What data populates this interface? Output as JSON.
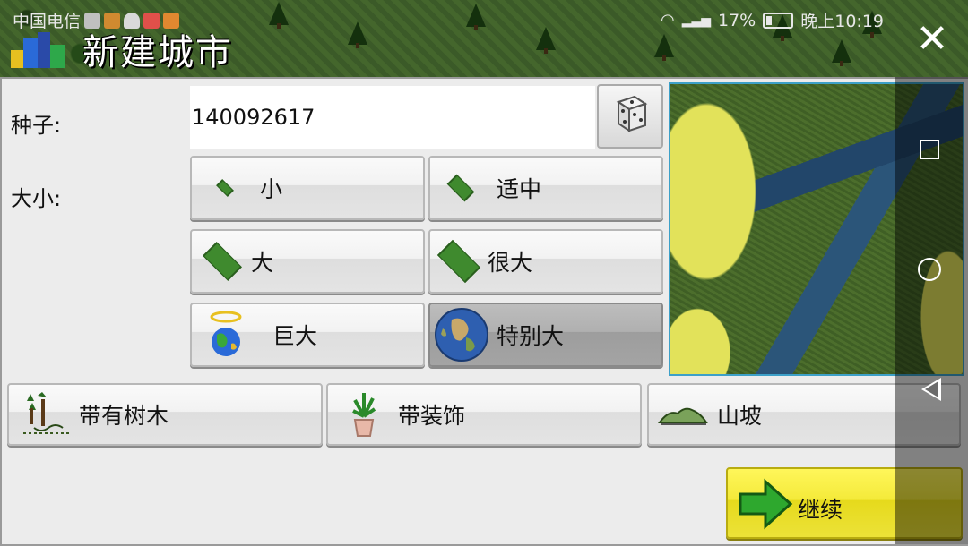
{
  "statusbar": {
    "carrier": "中国电信",
    "battery": "17%",
    "time": "晚上10:19"
  },
  "header": {
    "title": "新建城市",
    "city_icon": "city-buildings-icon",
    "close_icon": "close-icon"
  },
  "form": {
    "seed_label": "种子:",
    "seed_value": "140092617",
    "dice_icon": "dice-icon",
    "size_label": "大小:",
    "sizes": [
      {
        "label": "小",
        "icon": "small-tile-icon",
        "selected": false
      },
      {
        "label": "适中",
        "icon": "medium-tile-icon",
        "selected": false
      },
      {
        "label": "大",
        "icon": "large-tile-icon",
        "selected": false
      },
      {
        "label": "很大",
        "icon": "very-large-tile-icon",
        "selected": false
      },
      {
        "label": "巨大",
        "icon": "huge-globe-icon",
        "selected": false
      },
      {
        "label": "特别大",
        "icon": "earth-globe-icon",
        "selected": true
      }
    ],
    "options": [
      {
        "label": "带有树木",
        "icon": "trees-icon"
      },
      {
        "label": "带装饰",
        "icon": "potted-plant-icon"
      },
      {
        "label": "山坡",
        "icon": "hill-icon"
      }
    ],
    "continue_label": "继续",
    "continue_icon": "arrow-right-icon"
  },
  "colors": {
    "selected_button": "#a8a8a8",
    "continue_button": "#f4ea3a",
    "map_border": "#3da0c8"
  }
}
